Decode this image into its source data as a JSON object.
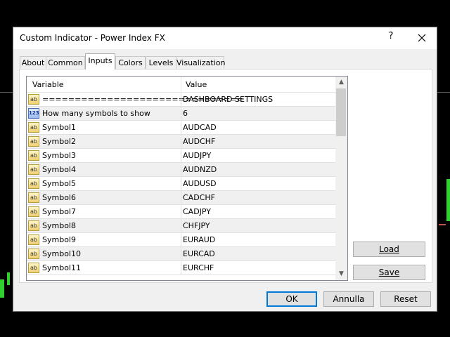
{
  "dialog": {
    "title": "Custom Indicator - Power Index FX",
    "help_label": "?",
    "close_label": "✕"
  },
  "tabs": [
    {
      "label": "About"
    },
    {
      "label": "Common"
    },
    {
      "label": "Inputs",
      "active": true
    },
    {
      "label": "Colors"
    },
    {
      "label": "Levels"
    },
    {
      "label": "Visualization"
    }
  ],
  "grid": {
    "headers": {
      "variable": "Variable",
      "value": "Value"
    },
    "rows": [
      {
        "icon": "text-icon",
        "variable": "===============================",
        "value": "DASHBOARD SETTINGS"
      },
      {
        "icon": "number-icon",
        "variable": "How many symbols to show",
        "value": "6"
      },
      {
        "icon": "text-icon",
        "variable": "Symbol1",
        "value": "AUDCAD"
      },
      {
        "icon": "text-icon",
        "variable": "Symbol2",
        "value": "AUDCHF"
      },
      {
        "icon": "text-icon",
        "variable": "Symbol3",
        "value": "AUDJPY"
      },
      {
        "icon": "text-icon",
        "variable": "Symbol4",
        "value": "AUDNZD"
      },
      {
        "icon": "text-icon",
        "variable": "Symbol5",
        "value": "AUDUSD"
      },
      {
        "icon": "text-icon",
        "variable": "Symbol6",
        "value": "CADCHF"
      },
      {
        "icon": "text-icon",
        "variable": "Symbol7",
        "value": "CADJPY"
      },
      {
        "icon": "text-icon",
        "variable": "Symbol8",
        "value": "CHFJPY"
      },
      {
        "icon": "text-icon",
        "variable": "Symbol9",
        "value": "EURAUD"
      },
      {
        "icon": "text-icon",
        "variable": "Symbol10",
        "value": "EURCAD"
      },
      {
        "icon": "text-icon",
        "variable": "Symbol11",
        "value": "EURCHF"
      }
    ]
  },
  "side_buttons": {
    "load": "Load",
    "save": "Save"
  },
  "footer": {
    "ok": "OK",
    "cancel": "Annulla",
    "reset": "Reset"
  },
  "colors": {
    "candle_green": "#2fd12f",
    "focus_blue": "#0078d7"
  }
}
